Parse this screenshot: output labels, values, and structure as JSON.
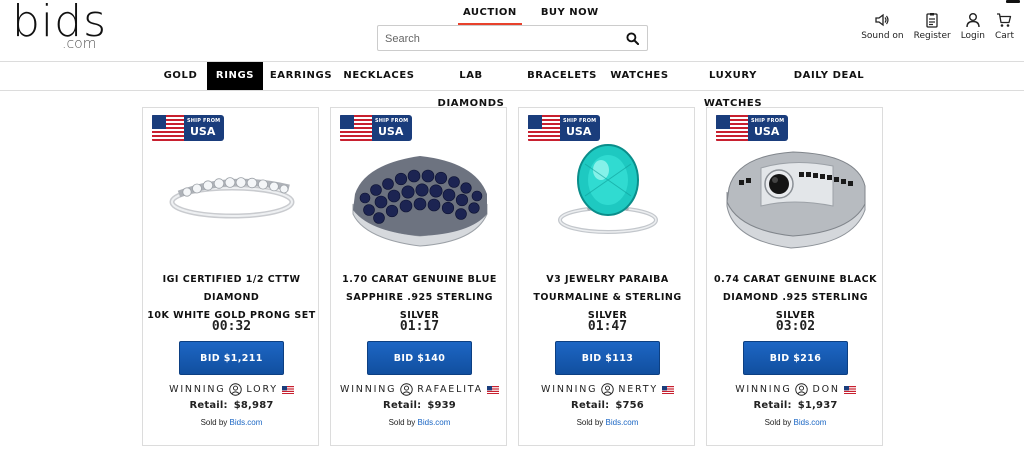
{
  "logo": {
    "main": "bids",
    "sub": ".com"
  },
  "mode_tabs": [
    {
      "label": "AUCTION",
      "active": true
    },
    {
      "label": "BUY NOW",
      "active": false
    }
  ],
  "search": {
    "placeholder": "Search",
    "icon": "search-icon"
  },
  "user_actions": [
    {
      "label": "Sound on",
      "icon": "speaker-icon"
    },
    {
      "label": "Register",
      "icon": "register-icon"
    },
    {
      "label": "Login",
      "icon": "user-icon"
    },
    {
      "label": "Cart",
      "icon": "cart-icon"
    }
  ],
  "categories": [
    {
      "label": "GOLD",
      "active": false
    },
    {
      "label": "RINGS",
      "active": true
    },
    {
      "label": "EARRINGS",
      "active": false
    },
    {
      "label": "NECKLACES",
      "active": false
    },
    {
      "label": "LAB DIAMONDS",
      "active": false
    },
    {
      "label": "BRACELETS",
      "active": false
    },
    {
      "label": "WATCHES",
      "active": false
    },
    {
      "label": "LUXURY WATCHES",
      "active": false
    },
    {
      "label": "DAILY DEAL",
      "active": false
    }
  ],
  "ship_badge": {
    "line1": "SHIP FROM",
    "line2": "USA"
  },
  "labels": {
    "winning": "WINNING",
    "retail": "Retail:",
    "sold_by": "Sold by",
    "seller": "Bids.com"
  },
  "products": [
    {
      "title_line1": "IGI CERTIFIED 1/2 CTTW DIAMOND",
      "title_line2": "10K WHITE GOLD PRONG SET",
      "timer": "00:32",
      "bid": "BID $1,211",
      "winner": "LORY",
      "retail": "$8,987",
      "image": "white-gold-diamond-band"
    },
    {
      "title_line1": "1.70 CARAT GENUINE BLUE",
      "title_line2": "SAPPHIRE .925 STERLING SILVER",
      "timer": "01:17",
      "bid": "BID $140",
      "winner": "RAFAELITA",
      "retail": "$939",
      "image": "blue-sapphire-ring"
    },
    {
      "title_line1": "V3 JEWELRY PARAIBA",
      "title_line2": "TOURMALINE & STERLING SILVER",
      "timer": "01:47",
      "bid": "BID $113",
      "winner": "NERTY",
      "retail": "$756",
      "image": "paraiba-tourmaline-ring"
    },
    {
      "title_line1": "0.74 CARAT GENUINE BLACK",
      "title_line2": "DIAMOND .925 STERLING SILVER",
      "timer": "03:02",
      "bid": "BID $216",
      "winner": "DON",
      "retail": "$1,937",
      "image": "black-diamond-ring"
    }
  ],
  "colors": {
    "accent_tab": "#e8412c",
    "bid_button": "#1560bd",
    "badge_blue": "#1a3d7c",
    "link": "#1a66c4"
  }
}
